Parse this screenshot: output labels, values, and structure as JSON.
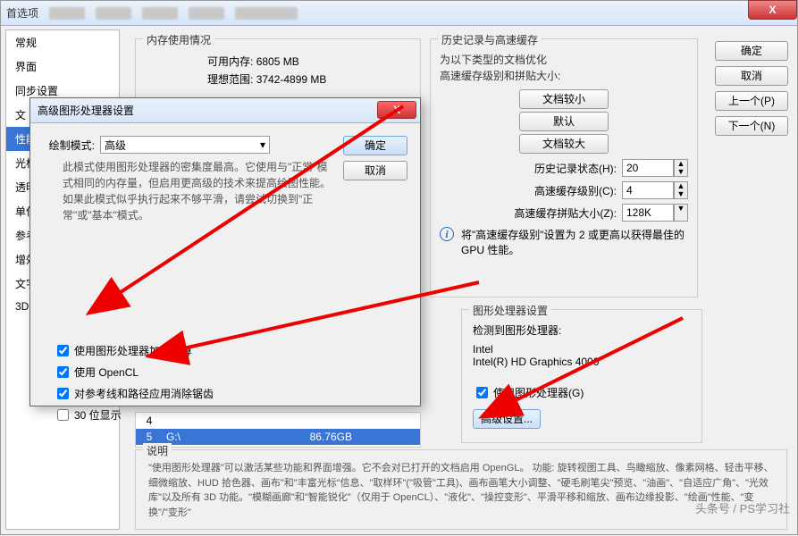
{
  "window": {
    "title": "首选项",
    "close": "X"
  },
  "sidebar": {
    "items": [
      "常规",
      "界面",
      "同步设置",
      "文",
      "性能",
      "光标",
      "透明",
      "单位",
      "参考",
      "增效",
      "文字",
      "3D"
    ]
  },
  "memory": {
    "group_label": "内存使用情况",
    "avail_label": "可用内存:",
    "avail_value": "6805 MB",
    "ideal_label": "理想范围:",
    "ideal_value": "3742-4899 MB"
  },
  "history": {
    "group_label": "历史记录与高速缓存",
    "opt_text1": "为以下类型的文档优化",
    "opt_text2": "高速缓存级别和拼贴大小:",
    "btn_small": "文档较小",
    "btn_default": "默认",
    "btn_large": "文档较大",
    "states_label": "历史记录状态(H):",
    "states_value": "20",
    "levels_label": "高速缓存级别(C):",
    "levels_value": "4",
    "tile_label": "高速缓存拼贴大小(Z):",
    "tile_value": "128K",
    "info_text": "将\"高速缓存级别\"设置为 2 或更高以获得最佳的 GPU 性能。"
  },
  "drives": {
    "r1": {
      "idx": "4",
      "drive": "",
      "size": ""
    },
    "r2": {
      "idx": "5",
      "drive": "G:\\",
      "size": "86.76GB"
    }
  },
  "gpu": {
    "group_label": "图形处理器设置",
    "detect_label": "检测到图形处理器:",
    "vendor": "Intel",
    "model": "Intel(R) HD Graphics 4000",
    "use_label": "使用图形处理器(G)",
    "adv_btn": "高级设置..."
  },
  "desc": {
    "group_label": "说明",
    "text": "\"使用图形处理器\"可以激活某些功能和界面增强。它不会对已打开的文档启用 OpenGL。\n功能: 旋转视图工具、鸟瞰缩放、像素网格、轻击平移、细微缩放、HUD 拾色器、画布\"和\"丰富光标\"信息、\"取样环\"(\"吸管\"工具)、画布画笔大小调整、\"硬毛刷笔尖\"预览、\"油画\"、\"自适应广角\"、\"光效库\"以及所有 3D 功能。\"模糊画廊\"和\"智能锐化\"（仅用于 OpenCL）、\"液化\"、\"操控变形\"、平滑平移和缩放、画布边缘投影、\"绘画\"性能、\"变换\"/\"变形\""
  },
  "modal": {
    "title": "高级图形处理器设置",
    "close": "X",
    "draw_label": "绘制模式:",
    "draw_value": "高级",
    "desc": "此模式使用图形处理器的密集度最高。它使用与\"正常\"模式相同的内存量，但启用更高级的技术来提高绘图性能。如果此模式似乎执行起来不够平滑，请尝试切换到\"正常\"或\"基本\"模式。",
    "ok": "确定",
    "cancel": "取消",
    "checks": {
      "accel": "使用图形处理器加速计算",
      "opencl": "使用 OpenCL",
      "antialias": "对参考线和路径应用消除锯齿",
      "bit30": "30 位显示"
    }
  },
  "right": {
    "ok": "确定",
    "cancel": "取消",
    "prev": "上一个(P)",
    "next": "下一个(N)"
  },
  "watermark": "头条号 / PS学习社"
}
